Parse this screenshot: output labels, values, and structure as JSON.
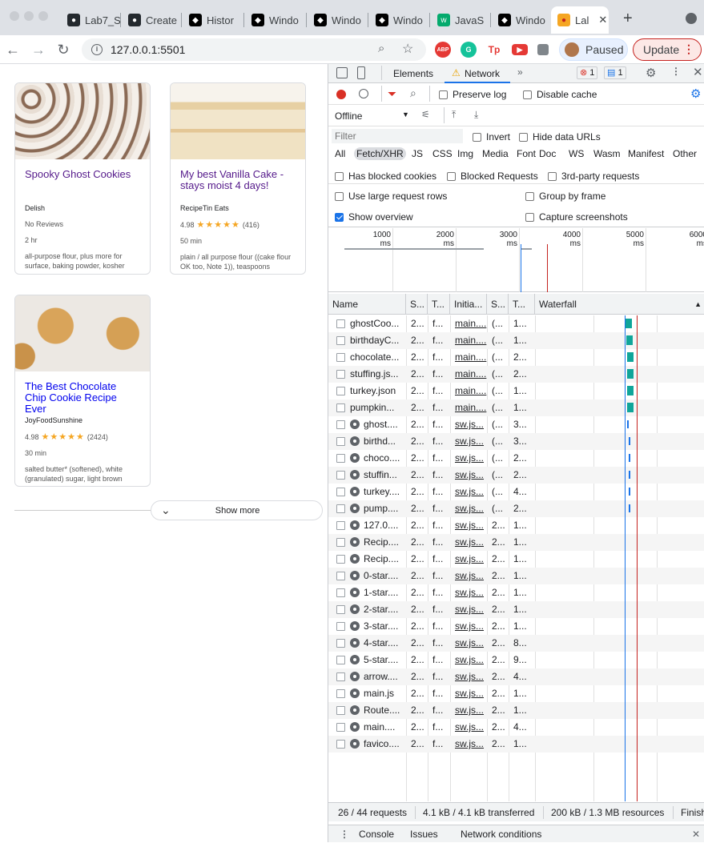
{
  "tabs": [
    {
      "label": "Lab7_S",
      "icon": "github-icon"
    },
    {
      "label": "Create",
      "icon": "github-icon"
    },
    {
      "label": "Histor",
      "icon": "window-icon"
    },
    {
      "label": "Windo",
      "icon": "window-icon"
    },
    {
      "label": "Windo",
      "icon": "window-icon"
    },
    {
      "label": "Windo",
      "icon": "window-icon"
    },
    {
      "label": "JavaS",
      "icon": "w3schools-icon"
    },
    {
      "label": "Windo",
      "icon": "window-icon"
    },
    {
      "label": "Lal",
      "icon": "recipe-icon"
    }
  ],
  "toolbar": {
    "url": "127.0.0.1:5501",
    "paused_label": "Paused",
    "update_label": "Update",
    "ext": [
      "ABP",
      "G",
      "Tp",
      "▶"
    ]
  },
  "page": {
    "cards": [
      {
        "title": "Spooky Ghost Cookies",
        "source": "Delish",
        "rating": "No Reviews",
        "stars": "",
        "count": "",
        "time": "2 hr",
        "ingredients": "all-purpose flour, plus more for surface, baking powder, kosher",
        "visited": true
      },
      {
        "title": "My best Vanilla Cake - stays moist 4 days!",
        "source": "RecipeTin Eats",
        "rating": "4.98",
        "stars": "★★★★★",
        "count": "(416)",
        "time": "50 min",
        "ingredients": "plain / all purpose flour ((cake flour OK too, Note 1)), teaspoons",
        "visited": true
      },
      {
        "title": "The Best Chocolate Chip Cookie Recipe Ever",
        "source": "JoyFoodSunshine",
        "rating": "4.98",
        "stars": "★★★★★",
        "count": "(2424)",
        "time": "30 min",
        "ingredients": "salted butter* (softened), white (granulated) sugar, light brown",
        "visited": false
      }
    ],
    "show_more": "Show more"
  },
  "devtools": {
    "tabs": [
      "Elements",
      "Network"
    ],
    "errors": "1",
    "messages": "1",
    "preserve_log": "Preserve log",
    "disable_cache": "Disable cache",
    "throttle": "Offline",
    "filter_placeholder": "Filter",
    "invert": "Invert",
    "hide_data_urls": "Hide data URLs",
    "types": [
      "All",
      "Fetch/XHR",
      "JS",
      "CSS",
      "Img",
      "Media",
      "Font",
      "Doc",
      "WS",
      "Wasm",
      "Manifest",
      "Other"
    ],
    "has_blocked_cookies": "Has blocked cookies",
    "blocked_requests": "Blocked Requests",
    "third_party": "3rd-party requests",
    "large_rows": "Use large request rows",
    "group_by_frame": "Group by frame",
    "show_overview": "Show overview",
    "capture_screenshots": "Capture screenshots",
    "timeline_ticks": [
      "1000 ms",
      "2000 ms",
      "3000 ms",
      "4000 ms",
      "5000 ms",
      "6000 ms"
    ],
    "columns": [
      "Name",
      "S...",
      "T...",
      "Initia...",
      "S...",
      "T...",
      "Waterfall"
    ],
    "rows": [
      {
        "name": "ghostCoo...",
        "s": "2...",
        "t": "f...",
        "init": "main....",
        "size": "(...",
        "time": "1...",
        "sw": false
      },
      {
        "name": "birthdayC...",
        "s": "2...",
        "t": "f...",
        "init": "main....",
        "size": "(...",
        "time": "1...",
        "sw": false
      },
      {
        "name": "chocolate...",
        "s": "2...",
        "t": "f...",
        "init": "main....",
        "size": "(...",
        "time": "2...",
        "sw": false
      },
      {
        "name": "stuffing.js...",
        "s": "2...",
        "t": "f...",
        "init": "main....",
        "size": "(...",
        "time": "2...",
        "sw": false
      },
      {
        "name": "turkey.json",
        "s": "2...",
        "t": "f...",
        "init": "main....",
        "size": "(...",
        "time": "1...",
        "sw": false
      },
      {
        "name": "pumpkin...",
        "s": "2...",
        "t": "f...",
        "init": "main....",
        "size": "(...",
        "time": "1...",
        "sw": false
      },
      {
        "name": "ghost....",
        "s": "2...",
        "t": "f...",
        "init": "sw.js...",
        "size": "(...",
        "time": "3...",
        "sw": true
      },
      {
        "name": "birthd...",
        "s": "2...",
        "t": "f...",
        "init": "sw.js...",
        "size": "(...",
        "time": "3...",
        "sw": true
      },
      {
        "name": "choco....",
        "s": "2...",
        "t": "f...",
        "init": "sw.js...",
        "size": "(...",
        "time": "2...",
        "sw": true
      },
      {
        "name": "stuffin...",
        "s": "2...",
        "t": "f...",
        "init": "sw.js...",
        "size": "(...",
        "time": "2...",
        "sw": true
      },
      {
        "name": "turkey....",
        "s": "2...",
        "t": "f...",
        "init": "sw.js...",
        "size": "(...",
        "time": "4...",
        "sw": true
      },
      {
        "name": "pump....",
        "s": "2...",
        "t": "f...",
        "init": "sw.js...",
        "size": "(...",
        "time": "2...",
        "sw": true
      },
      {
        "name": "127.0....",
        "s": "2...",
        "t": "f...",
        "init": "sw.js...",
        "size": "2...",
        "time": "1...",
        "sw": true
      },
      {
        "name": "Recip....",
        "s": "2...",
        "t": "f...",
        "init": "sw.js...",
        "size": "2...",
        "time": "1...",
        "sw": true
      },
      {
        "name": "Recip....",
        "s": "2...",
        "t": "f...",
        "init": "sw.js...",
        "size": "2...",
        "time": "1...",
        "sw": true
      },
      {
        "name": "0-star....",
        "s": "2...",
        "t": "f...",
        "init": "sw.js...",
        "size": "2...",
        "time": "1...",
        "sw": true
      },
      {
        "name": "1-star....",
        "s": "2...",
        "t": "f...",
        "init": "sw.js...",
        "size": "2...",
        "time": "1...",
        "sw": true
      },
      {
        "name": "2-star....",
        "s": "2...",
        "t": "f...",
        "init": "sw.js...",
        "size": "2...",
        "time": "1...",
        "sw": true
      },
      {
        "name": "3-star....",
        "s": "2...",
        "t": "f...",
        "init": "sw.js...",
        "size": "2...",
        "time": "1...",
        "sw": true
      },
      {
        "name": "4-star....",
        "s": "2...",
        "t": "f...",
        "init": "sw.js...",
        "size": "2...",
        "time": "8...",
        "sw": true
      },
      {
        "name": "5-star....",
        "s": "2...",
        "t": "f...",
        "init": "sw.js...",
        "size": "2...",
        "time": "9...",
        "sw": true
      },
      {
        "name": "arrow....",
        "s": "2...",
        "t": "f...",
        "init": "sw.js...",
        "size": "2...",
        "time": "4...",
        "sw": true
      },
      {
        "name": "main.js",
        "s": "2...",
        "t": "f...",
        "init": "sw.js...",
        "size": "2...",
        "time": "1...",
        "sw": true
      },
      {
        "name": "Route....",
        "s": "2...",
        "t": "f...",
        "init": "sw.js...",
        "size": "2...",
        "time": "1...",
        "sw": true
      },
      {
        "name": "main....",
        "s": "2...",
        "t": "f...",
        "init": "sw.js...",
        "size": "2...",
        "time": "4...",
        "sw": true
      },
      {
        "name": "favico....",
        "s": "2...",
        "t": "f...",
        "init": "sw.js...",
        "size": "2...",
        "time": "1...",
        "sw": true
      }
    ],
    "status": [
      "26 / 44 requests",
      "4.1 kB / 4.1 kB transferred",
      "200 kB / 1.3 MB resources",
      "Finish"
    ],
    "drawer_tabs": [
      "Console",
      "Issues",
      "Network conditions"
    ]
  }
}
